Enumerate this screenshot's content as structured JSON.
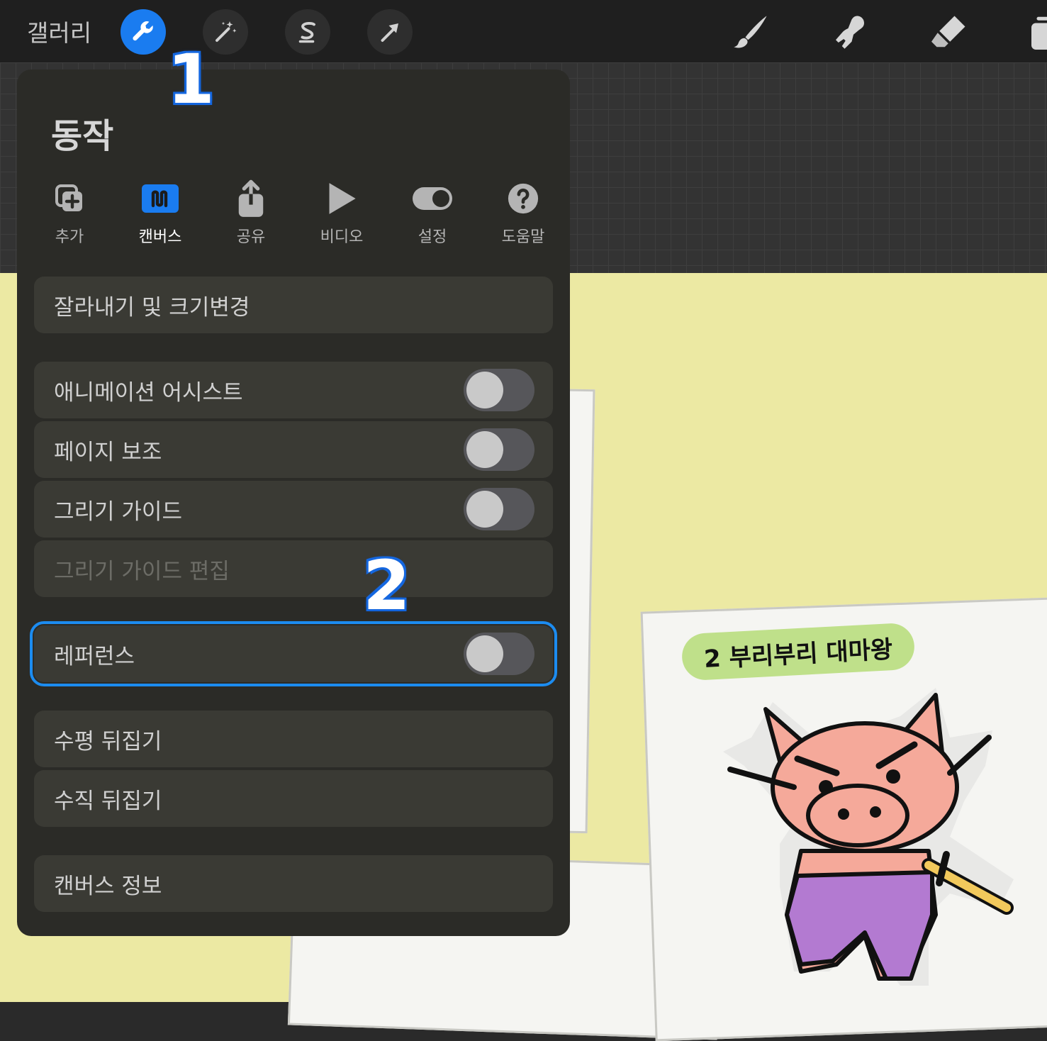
{
  "topbar": {
    "gallery_label": "갤러리",
    "left_tools": [
      {
        "icon": "wrench-icon",
        "active": true
      },
      {
        "icon": "magic-wand-icon",
        "active": false
      },
      {
        "icon": "selection-s-icon",
        "active": false
      },
      {
        "icon": "transform-arrow-icon",
        "active": false
      }
    ],
    "right_tools": [
      "brush-icon",
      "smudge-icon",
      "eraser-icon",
      "layers-icon"
    ]
  },
  "annotations": {
    "one": "1",
    "two": "2"
  },
  "panel": {
    "title": "동작",
    "tabs": [
      {
        "label": "추가",
        "icon": "add-icon",
        "active": false
      },
      {
        "label": "캔버스",
        "icon": "canvas-icon",
        "active": true
      },
      {
        "label": "공유",
        "icon": "share-icon",
        "active": false
      },
      {
        "label": "비디오",
        "icon": "play-icon",
        "active": false
      },
      {
        "label": "설정",
        "icon": "toggle-settings-icon",
        "active": false
      },
      {
        "label": "도움말",
        "icon": "help-icon",
        "active": false
      }
    ],
    "rows": {
      "crop_resize": "잘라내기 및 크기변경",
      "animation_assist": "애니메이션 어시스트",
      "page_assist": "페이지 보조",
      "drawing_guide": "그리기 가이드",
      "edit_drawing_guide": "그리기 가이드 편집",
      "reference": "레퍼런스",
      "flip_horizontal": "수평 뒤집기",
      "flip_vertical": "수직 뒤집기",
      "canvas_info": "캔버스 정보"
    }
  },
  "artwork": {
    "label_text": "2 부리부리 대마왕"
  },
  "colors": {
    "accent": "#1a7cf0",
    "toolbar_bg": "#1f1f1f",
    "panel_bg": "#2b2b27",
    "canvas_bg": "#ece9a3",
    "label_green": "#bfe08a",
    "pig_pink": "#f5a99a",
    "pants_purple": "#b37ad1"
  }
}
